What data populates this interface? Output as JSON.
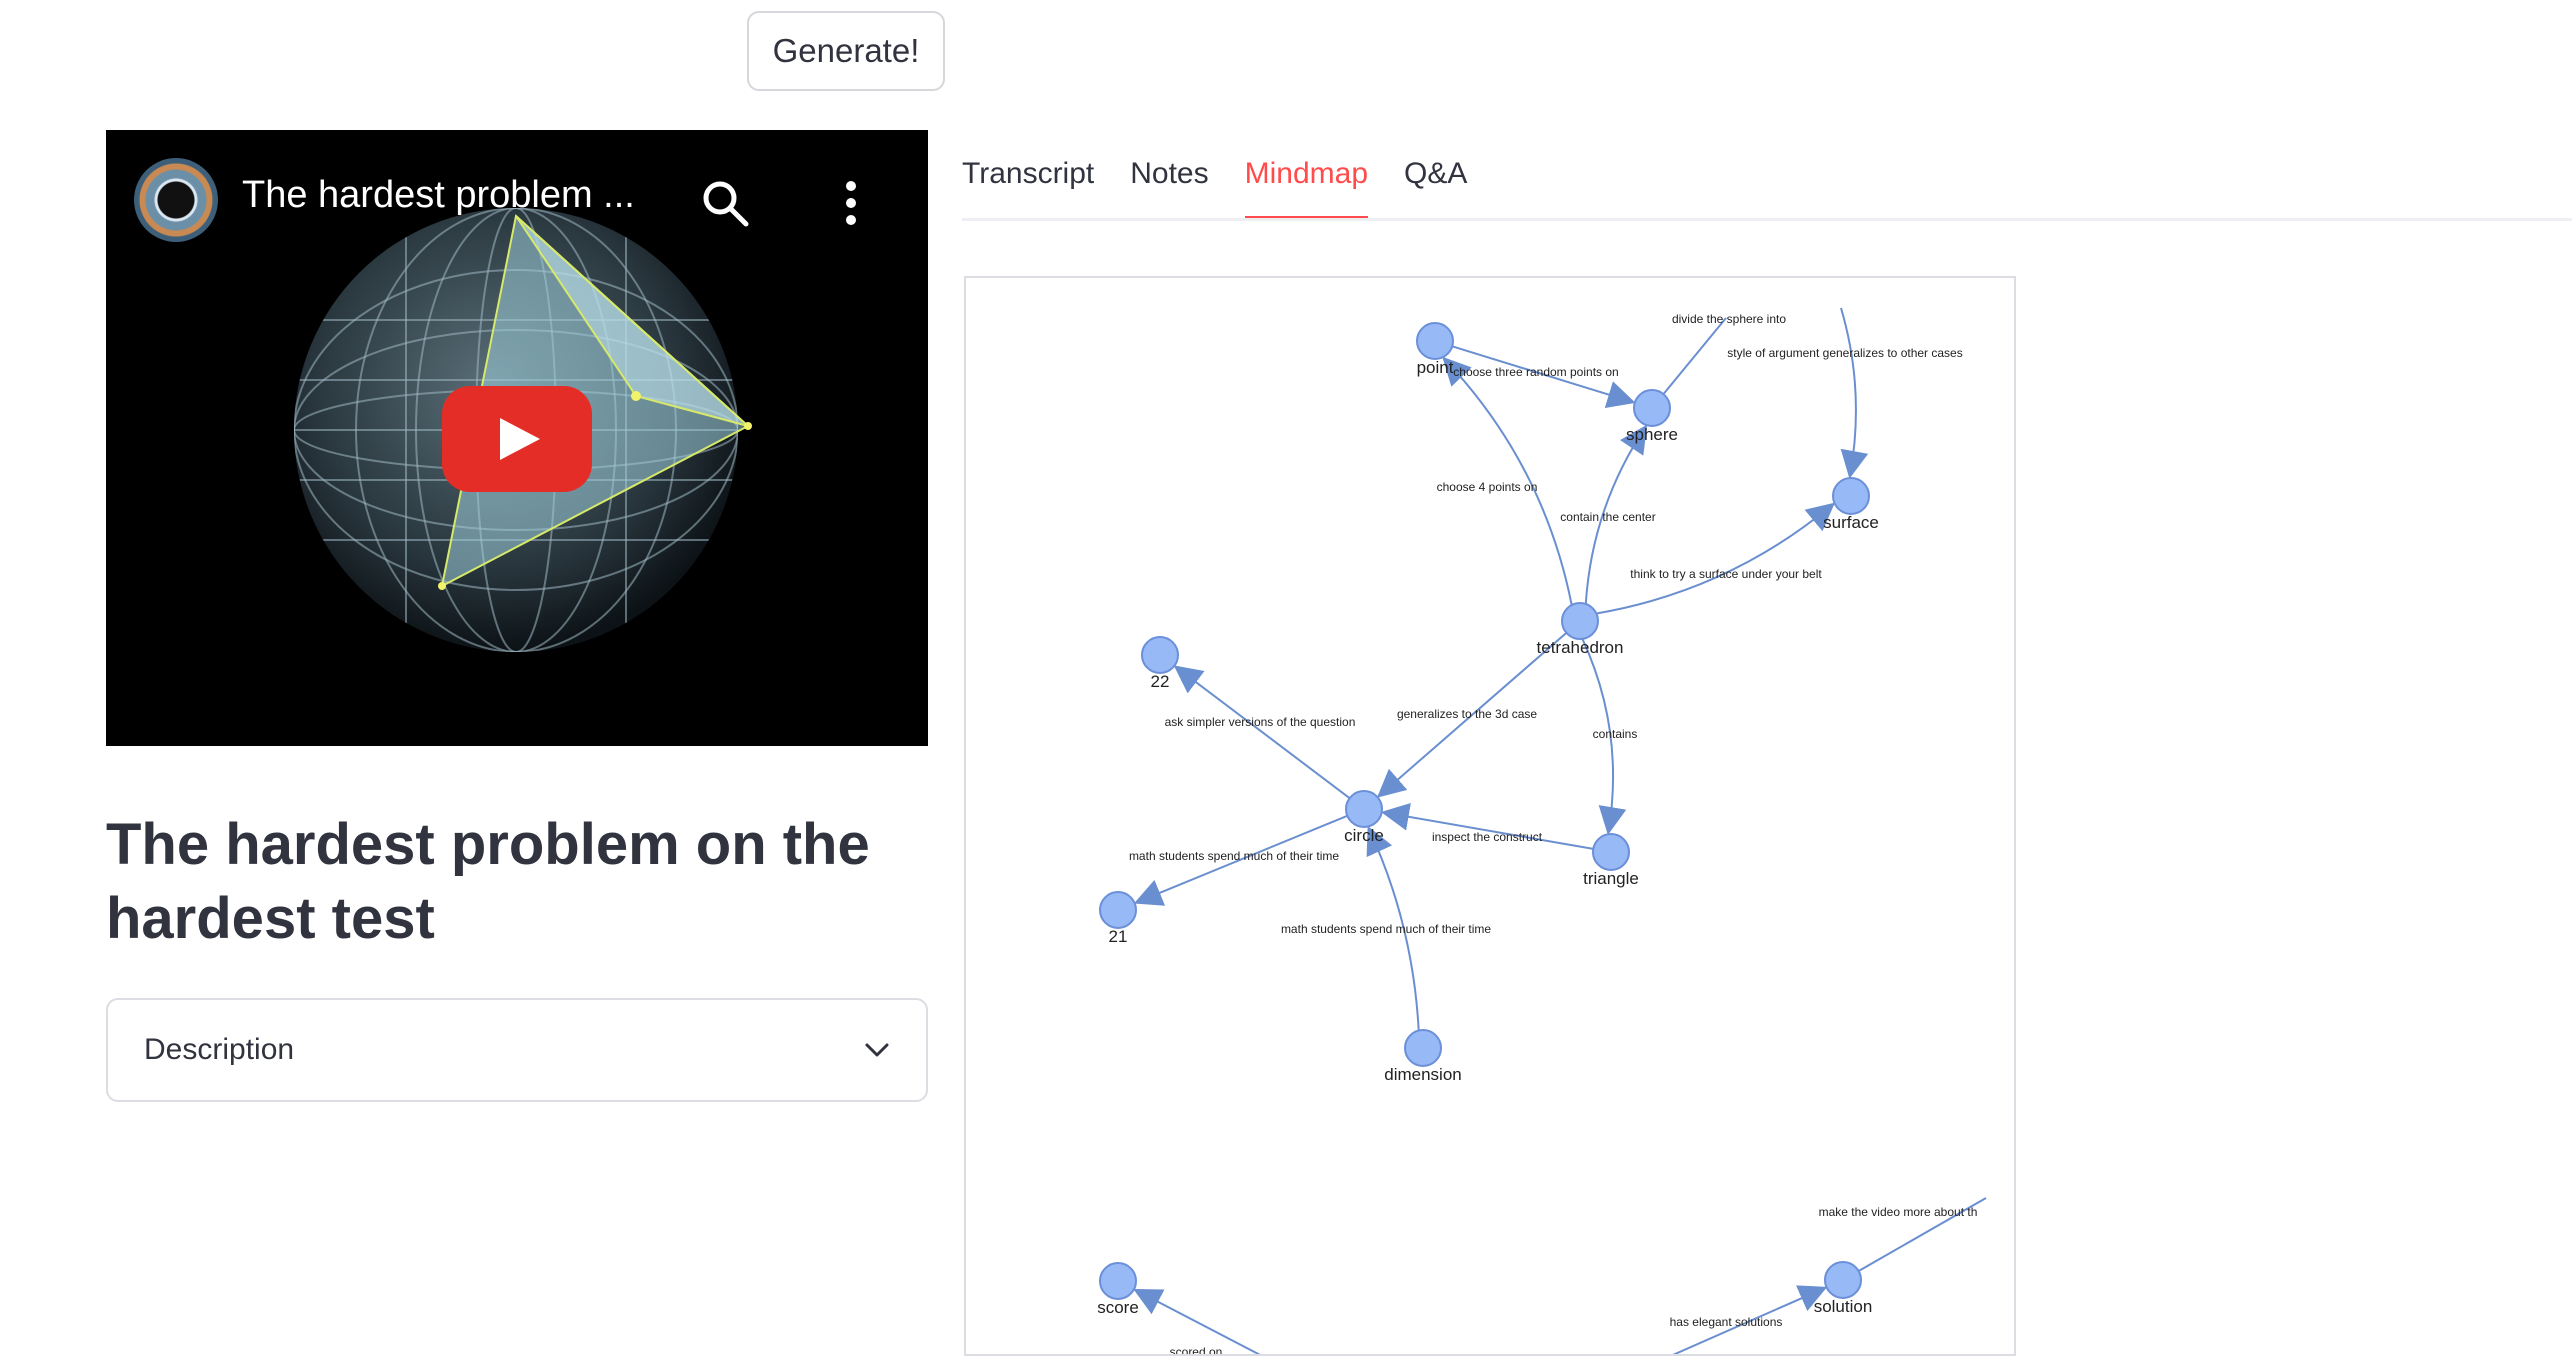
{
  "toolbar": {
    "generate_label": "Generate!"
  },
  "video": {
    "title": "The hardest problem ...",
    "icons": {
      "avatar": "channel-avatar",
      "search": "search-icon",
      "menu": "more-vert-icon",
      "play": "youtube-play-icon"
    }
  },
  "page": {
    "title": "The hardest problem on the hardest test"
  },
  "description": {
    "label": "Description",
    "icon": "chevron-down-icon"
  },
  "tabs": [
    {
      "label": "Transcript",
      "active": false
    },
    {
      "label": "Notes",
      "active": false
    },
    {
      "label": "Mindmap",
      "active": true
    },
    {
      "label": "Q&A",
      "active": false
    }
  ],
  "colors": {
    "accent": "#ff4b4b",
    "node_fill": "#97b9f6",
    "node_stroke": "#6b8fd8",
    "edge": "#6a8fd0"
  },
  "mindmap": {
    "nodes": [
      {
        "id": "point",
        "label": "point"
      },
      {
        "id": "sphere",
        "label": "sphere"
      },
      {
        "id": "surface",
        "label": "surface"
      },
      {
        "id": "tetrahedron",
        "label": "tetrahedron"
      },
      {
        "id": "n22",
        "label": "22"
      },
      {
        "id": "circle",
        "label": "circle"
      },
      {
        "id": "triangle",
        "label": "triangle"
      },
      {
        "id": "n21",
        "label": "21"
      },
      {
        "id": "dimension",
        "label": "dimension"
      },
      {
        "id": "score",
        "label": "score"
      },
      {
        "id": "solution",
        "label": "solution"
      }
    ],
    "edges": [
      {
        "from": "point",
        "to": "sphere",
        "label": "choose three random points on"
      },
      {
        "from": "tetrahedron",
        "to": "point",
        "label": "choose 4 points on"
      },
      {
        "from": "tetrahedron",
        "to": "sphere",
        "label": "contain the center"
      },
      {
        "from": "tetrahedron",
        "to": "surface",
        "label": "think to try a surface under your belt"
      },
      {
        "from": "tetrahedron",
        "to": "circle",
        "label": "generalizes to the 3d case"
      },
      {
        "from": "tetrahedron",
        "to": "triangle",
        "label": "contains"
      },
      {
        "from": "circle",
        "to": "n22",
        "label": "ask simpler versions of the question"
      },
      {
        "from": "circle",
        "to": "n21",
        "label": "math students spend much of their time"
      },
      {
        "from": "triangle",
        "to": "circle",
        "label": "inspect the construct"
      },
      {
        "from": "dimension",
        "to": "circle",
        "label": "math students spend much of their time"
      },
      {
        "from": "sphere",
        "to": "offscreen-a",
        "label": "divide the sphere into"
      },
      {
        "from": "offscreen-b",
        "to": "surface",
        "label": "style of argument generalizes to other cases"
      },
      {
        "from": "offscreen-c",
        "to": "score",
        "label": "scored on"
      },
      {
        "from": "offscreen-d",
        "to": "solution",
        "label": "has elegant solutions"
      },
      {
        "from": "solution",
        "to": "offscreen-e",
        "label": "make the video more about th"
      }
    ]
  }
}
